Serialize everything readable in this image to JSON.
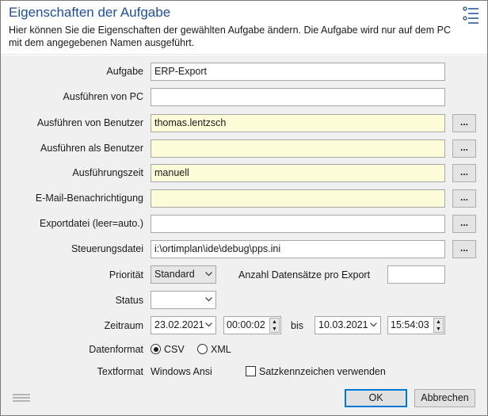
{
  "dialog": {
    "title": "Eigenschaften der Aufgabe",
    "subtitle": "Hier können Sie die Eigenschaften der gewählten Aufgabe ändern. Die Aufgabe wird nur auf dem PC mit dem angegebenen Namen ausgeführt.",
    "header_icon": "list-settings-icon"
  },
  "fields": {
    "aufgabe": {
      "label": "Aufgabe",
      "value": "ERP-Export"
    },
    "ausfuehren_pc": {
      "label": "Ausführen von PC",
      "value": ""
    },
    "ausfuehren_benutzer": {
      "label": "Ausführen von Benutzer",
      "value": "thomas.lentzsch"
    },
    "ausfuehren_als": {
      "label": "Ausführen als Benutzer",
      "value": ""
    },
    "ausfuehrungszeit": {
      "label": "Ausführungszeit",
      "value": "manuell"
    },
    "email": {
      "label": "E-Mail-Benachrichtigung",
      "value": ""
    },
    "exportdatei": {
      "label": "Exportdatei (leer=auto.)",
      "value": ""
    },
    "steuerungsdatei": {
      "label": "Steuerungsdatei",
      "value": "i:\\ortimplan\\ide\\debug\\pps.ini"
    }
  },
  "browse_label": "...",
  "prioritaet": {
    "label": "Priorität",
    "selected": "Standard"
  },
  "anzahl": {
    "label": "Anzahl Datensätze pro Export",
    "value": ""
  },
  "status": {
    "label": "Status",
    "selected": ""
  },
  "zeitraum": {
    "label": "Zeitraum",
    "from_date": "23.02.2021",
    "from_time": "00:00:02",
    "bis_label": "bis",
    "to_date": "10.03.2021",
    "to_time": "15:54:03"
  },
  "datenformat": {
    "label": "Datenformat",
    "options": [
      {
        "label": "CSV",
        "selected": true
      },
      {
        "label": "XML",
        "selected": false
      }
    ]
  },
  "textformat": {
    "label": "Textformat",
    "value": "Windows Ansi",
    "checkbox_label": "Satzkennzeichen verwenden",
    "checked": false
  },
  "buttons": {
    "ok": "OK",
    "cancel": "Abbrechen"
  },
  "colors": {
    "title": "#1f4f96",
    "required_field_bg": "#fdfcd9",
    "body_bg": "#f0f0f0",
    "default_button_border": "#0078d7"
  }
}
